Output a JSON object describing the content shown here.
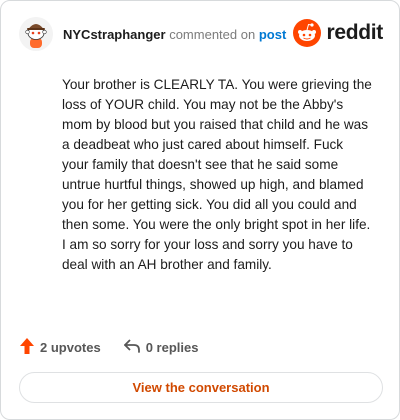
{
  "header": {
    "username": "NYCstraphanger",
    "action": "commented on",
    "post_link": "post",
    "brand": "reddit",
    "brand_color": "#ff4500"
  },
  "comment": {
    "text": "Your brother is CLEARLY TA. You were grieving the loss of YOUR child. You may not be the Abby's mom by blood but you raised that child and he was a deadbeat who just cared about himself. Fuck your family that doesn't see that he said some untrue hurtful things, showed up high, and blamed you for her getting sick. You did all you could and then some. You were the only bright spot in her life. I am so sorry for your loss and sorry you have to deal with an AH brother and family."
  },
  "footer": {
    "upvotes": "2 upvotes",
    "replies": "0 replies",
    "upvote_icon": "upvote-arrow-icon",
    "reply_icon": "reply-arrow-icon",
    "view_button": "View the conversation",
    "accent": "#d14900"
  }
}
